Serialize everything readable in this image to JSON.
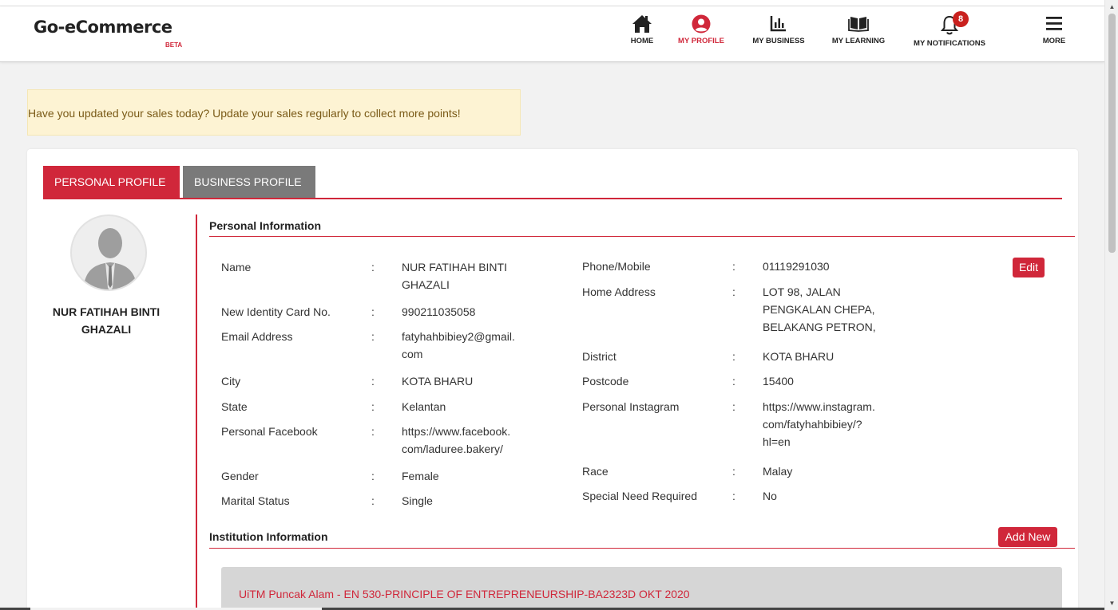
{
  "app": {
    "logo": "Go-eCommerce",
    "beta": "BETA"
  },
  "nav": {
    "items": [
      {
        "label": "HOME",
        "icon": "home-icon"
      },
      {
        "label": "MY PROFILE",
        "icon": "user-circle-icon"
      },
      {
        "label": "MY BUSINESS",
        "icon": "bar-chart-icon"
      },
      {
        "label": "MY LEARNING",
        "icon": "book-icon"
      },
      {
        "label": "MY NOTIFICATIONS",
        "icon": "bell-icon",
        "badge": "8"
      },
      {
        "label": "MORE",
        "icon": "menu-icon"
      }
    ],
    "active": "MY PROFILE"
  },
  "alert": {
    "text": "Have you updated your sales today? Update your sales regularly to collect more points!"
  },
  "tabs": {
    "personal": "PERSONAL PROFILE",
    "business": "BUSINESS PROFILE"
  },
  "profile": {
    "name_line1": "NUR FATIHAH BINTI",
    "name_line2": "GHAZALI"
  },
  "personal_info": {
    "title": "Personal Information",
    "edit_label": "Edit",
    "left": {
      "name_label": "Name",
      "name_value_1": "NUR FATIHAH BINTI",
      "name_value_2": "GHAZALI",
      "ic_label": "New Identity Card No.",
      "ic_value": "990211035058",
      "email_label": "Email Address",
      "email_value_1": "fatyhahbibiey2@gmail.",
      "email_value_2": "com",
      "city_label": "City",
      "city_value": "KOTA BHARU",
      "state_label": "State",
      "state_value": "Kelantan",
      "facebook_label": "Personal Facebook",
      "facebook_value_1": "https://www.facebook.",
      "facebook_value_2": "com/laduree.bakery/",
      "gender_label": "Gender",
      "gender_value": "Female",
      "marital_label": "Marital Status",
      "marital_value": "Single"
    },
    "right": {
      "phone_label": "Phone/Mobile",
      "phone_value": "01119291030",
      "address_label": "Home Address",
      "address_value_1": "LOT 98, JALAN",
      "address_value_2": "PENGKALAN CHEPA,",
      "address_value_3": "BELAKANG PETRON,",
      "district_label": "District",
      "district_value": "KOTA BHARU",
      "postcode_label": "Postcode",
      "postcode_value": "15400",
      "instagram_label": "Personal Instagram",
      "instagram_value_1": "https://www.instagram.",
      "instagram_value_2": "com/fatyhahbibiey/?",
      "instagram_value_3": "hl=en",
      "race_label": "Race",
      "race_value": "Malay",
      "special_label": "Special Need Required",
      "special_value": "No"
    },
    "colon": ":"
  },
  "institution": {
    "title": "Institution Information",
    "add_label": "Add New",
    "items": [
      "UiTM Puncak Alam - EN 530-PRINCIPLE OF ENTREPRENEURSHIP-BA2323D OKT 2020"
    ]
  }
}
